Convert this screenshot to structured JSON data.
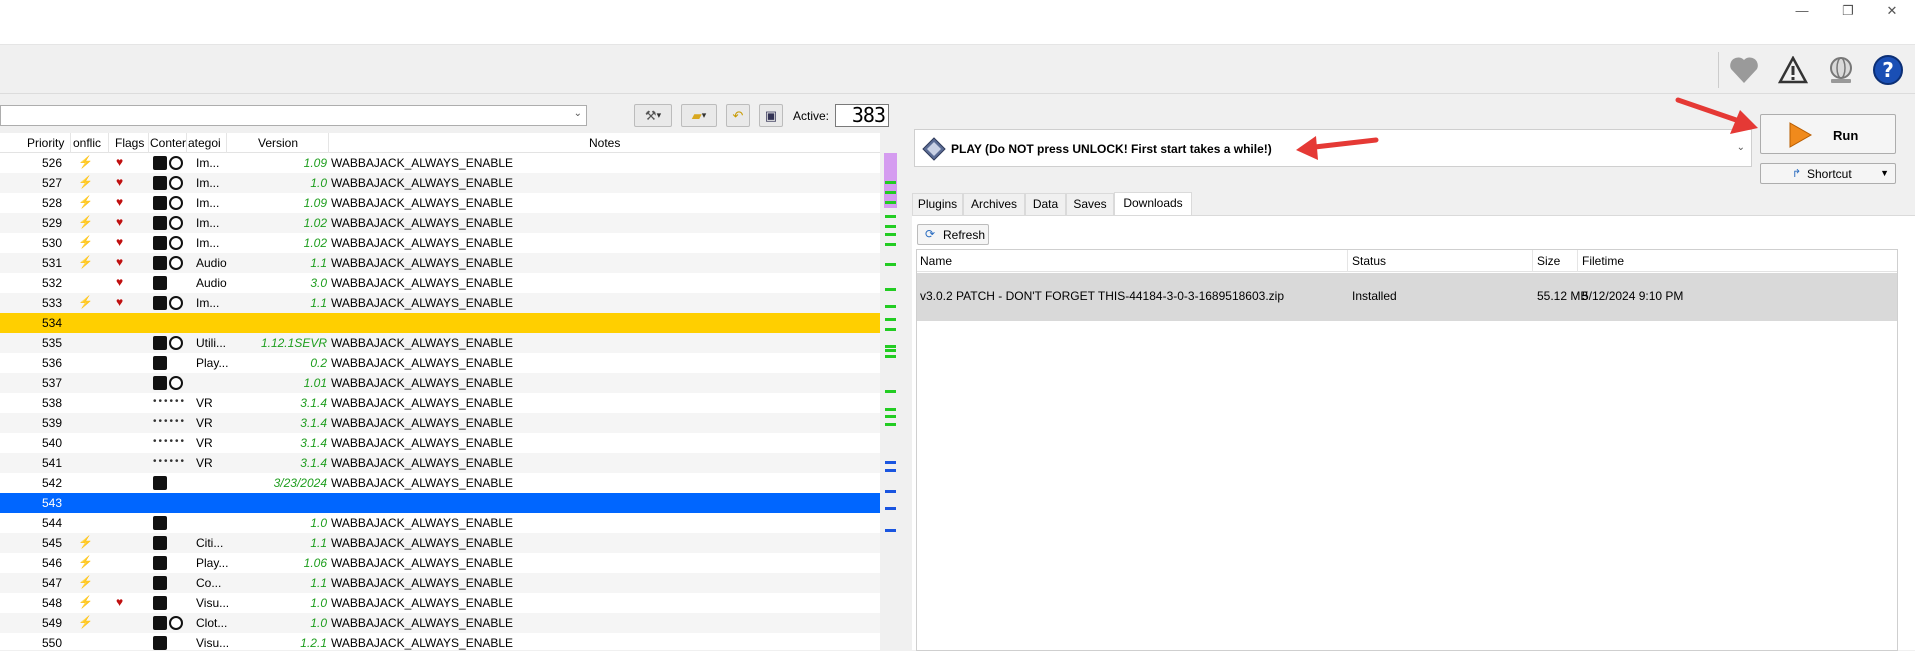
{
  "window": {
    "minimize": "—",
    "restore": "❐",
    "close": "✕"
  },
  "toolbar": {
    "right_icons": [
      "heart-icon",
      "warning-icon",
      "globe-icon",
      "help-icon"
    ]
  },
  "filter": {
    "value": ""
  },
  "active": {
    "label": "Active:",
    "count": "383"
  },
  "modlist": {
    "headers": {
      "priority": "Priority",
      "conflicts": "onflic",
      "flags": "Flags",
      "content": "Conter",
      "category": "ategoi",
      "version": "Version",
      "notes": "Notes"
    },
    "rows": [
      {
        "priority": "526",
        "conflict": true,
        "flag": true,
        "content": "icons",
        "category": "Im...",
        "version": "1.09",
        "notes": "WABBAJACK_ALWAYS_ENABLE"
      },
      {
        "priority": "527",
        "conflict": true,
        "flag": true,
        "content": "icons",
        "category": "Im...",
        "version": "1.0",
        "notes": "WABBAJACK_ALWAYS_ENABLE"
      },
      {
        "priority": "528",
        "conflict": true,
        "flag": true,
        "content": "icons",
        "category": "Im...",
        "version": "1.09",
        "notes": "WABBAJACK_ALWAYS_ENABLE"
      },
      {
        "priority": "529",
        "conflict": true,
        "flag": true,
        "content": "icons",
        "category": "Im...",
        "version": "1.02",
        "notes": "WABBAJACK_ALWAYS_ENABLE"
      },
      {
        "priority": "530",
        "conflict": true,
        "flag": true,
        "content": "icons",
        "category": "Im...",
        "version": "1.02",
        "notes": "WABBAJACK_ALWAYS_ENABLE"
      },
      {
        "priority": "531",
        "conflict": true,
        "flag": true,
        "content": "icons",
        "category": "Audio",
        "version": "1.1",
        "notes": "WABBAJACK_ALWAYS_ENABLE"
      },
      {
        "priority": "532",
        "conflict": false,
        "flag": true,
        "content": "icon1",
        "category": "Audio",
        "version": "3.0",
        "notes": "WABBAJACK_ALWAYS_ENABLE"
      },
      {
        "priority": "533",
        "conflict": true,
        "flag": true,
        "content": "icons",
        "category": "Im...",
        "version": "1.1",
        "notes": "WABBAJACK_ALWAYS_ENABLE"
      },
      {
        "priority": "534",
        "separator": "yellow",
        "version": "",
        "notes": "",
        "category": ""
      },
      {
        "priority": "535",
        "conflict": false,
        "flag": false,
        "content": "icons",
        "category": "Utili...",
        "version": "1.12.1SEVR",
        "notes": "WABBAJACK_ALWAYS_ENABLE"
      },
      {
        "priority": "536",
        "conflict": false,
        "flag": false,
        "content": "icon1",
        "category": "Play...",
        "version": "0.2",
        "notes": "WABBAJACK_ALWAYS_ENABLE"
      },
      {
        "priority": "537",
        "conflict": false,
        "flag": false,
        "content": "icons",
        "category": "",
        "version": "1.01",
        "notes": "WABBAJACK_ALWAYS_ENABLE"
      },
      {
        "priority": "538",
        "conflict": false,
        "flag": false,
        "content": "dots",
        "category": "VR",
        "version": "3.1.4",
        "notes": "WABBAJACK_ALWAYS_ENABLE"
      },
      {
        "priority": "539",
        "conflict": false,
        "flag": false,
        "content": "dots",
        "category": "VR",
        "version": "3.1.4",
        "notes": "WABBAJACK_ALWAYS_ENABLE"
      },
      {
        "priority": "540",
        "conflict": false,
        "flag": false,
        "content": "dots",
        "category": "VR",
        "version": "3.1.4",
        "notes": "WABBAJACK_ALWAYS_ENABLE"
      },
      {
        "priority": "541",
        "conflict": false,
        "flag": false,
        "content": "dots",
        "category": "VR",
        "version": "3.1.4",
        "notes": "WABBAJACK_ALWAYS_ENABLE"
      },
      {
        "priority": "542",
        "conflict": false,
        "flag": false,
        "content": "icon1",
        "category": "",
        "version": "3/23/2024",
        "notes": "WABBAJACK_ALWAYS_ENABLE"
      },
      {
        "priority": "543",
        "separator": "blue",
        "version": "",
        "notes": "",
        "category": ""
      },
      {
        "priority": "544",
        "conflict": false,
        "flag": false,
        "content": "icon1",
        "category": "",
        "version": "1.0",
        "notes": "WABBAJACK_ALWAYS_ENABLE"
      },
      {
        "priority": "545",
        "conflict": true,
        "flag": false,
        "content": "icon1",
        "category": "Citi...",
        "version": "1.1",
        "notes": "WABBAJACK_ALWAYS_ENABLE"
      },
      {
        "priority": "546",
        "conflict": true,
        "flag": false,
        "content": "icon1",
        "category": "Play...",
        "version": "1.06",
        "notes": "WABBAJACK_ALWAYS_ENABLE"
      },
      {
        "priority": "547",
        "conflict": true,
        "flag": false,
        "content": "icon1",
        "category": "Co...",
        "version": "1.1",
        "notes": "WABBAJACK_ALWAYS_ENABLE"
      },
      {
        "priority": "548",
        "conflict": true,
        "flag": true,
        "content": "icon1",
        "category": "Visu...",
        "version": "1.0",
        "notes": "WABBAJACK_ALWAYS_ENABLE"
      },
      {
        "priority": "549",
        "conflict": true,
        "flag": false,
        "content": "icons",
        "category": "Clot...",
        "version": "1.0",
        "notes": "WABBAJACK_ALWAYS_ENABLE"
      },
      {
        "priority": "550",
        "conflict": false,
        "flag": false,
        "content": "icon1",
        "category": "Visu...",
        "version": "1.2.1",
        "notes": "WABBAJACK_ALWAYS_ENABLE"
      }
    ]
  },
  "profile": {
    "selected": "PLAY (Do NOT press UNLOCK! First start takes a while!)"
  },
  "run": {
    "label": "Run"
  },
  "shortcut": {
    "label": "Shortcut"
  },
  "tabs": [
    "Plugins",
    "Archives",
    "Data",
    "Saves",
    "Downloads"
  ],
  "downloads": {
    "refresh_label": "Refresh",
    "headers": {
      "name": "Name",
      "status": "Status",
      "size": "Size",
      "filetime": "Filetime"
    },
    "rows": [
      {
        "name": "v3.0.2 PATCH  - DON'T FORGET THIS-44184-3-0-3-1689518603.zip",
        "status": "Installed",
        "size": "55.12 MB",
        "filetime": "5/12/2024 9:10 PM"
      }
    ]
  }
}
